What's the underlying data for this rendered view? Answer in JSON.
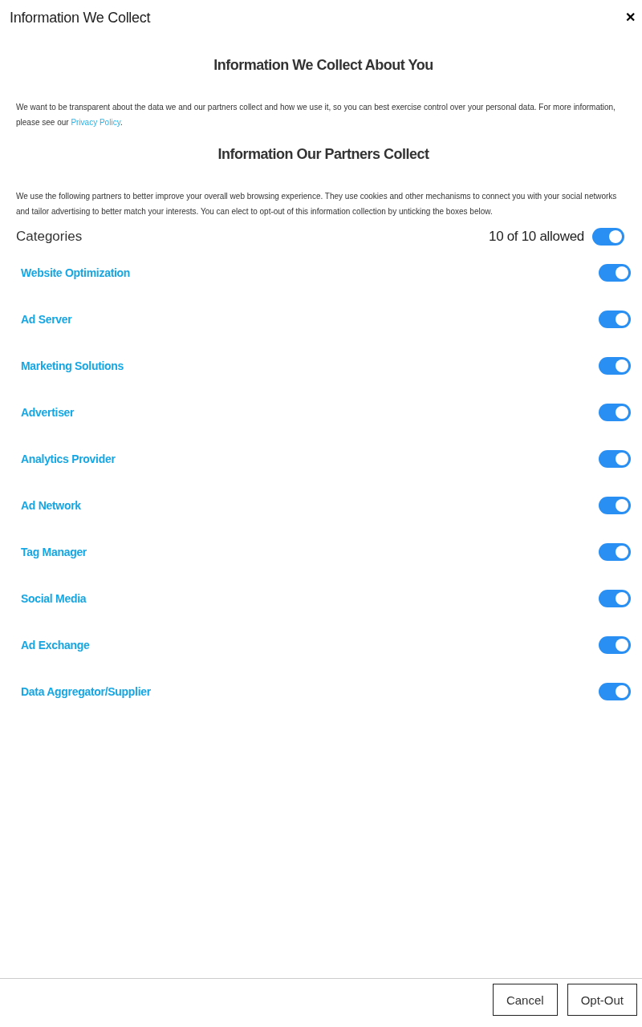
{
  "header": {
    "title": "Information We Collect",
    "close": "✕"
  },
  "intro": {
    "heading": "Information We Collect About You",
    "text": "We want to be transparent about the data we and our partners collect and how we use it, so you can best exercise control over your personal data. For more information, please see our ",
    "link": "Privacy Policy",
    "after": "."
  },
  "partners": {
    "heading": "Information Our Partners Collect",
    "text": "We use the following partners to better improve your overall web browsing experience. They use cookies and other mechanisms to connect you with your social networks and tailor advertising to better match your interests. You can elect to opt-out of this information collection by unticking the boxes below."
  },
  "categories": {
    "label": "Categories",
    "count": "10 of 10 allowed",
    "all_on": true,
    "items": [
      {
        "name": "Website Optimization",
        "on": true
      },
      {
        "name": "Ad Server",
        "on": true
      },
      {
        "name": "Marketing Solutions",
        "on": true
      },
      {
        "name": "Advertiser",
        "on": true
      },
      {
        "name": "Analytics Provider",
        "on": true
      },
      {
        "name": "Ad Network",
        "on": true
      },
      {
        "name": "Tag Manager",
        "on": true
      },
      {
        "name": "Social Media",
        "on": true
      },
      {
        "name": "Ad Exchange",
        "on": true
      },
      {
        "name": "Data Aggregator/Supplier",
        "on": true
      }
    ]
  },
  "buttons": [
    "Cancel",
    "Opt-Out"
  ]
}
